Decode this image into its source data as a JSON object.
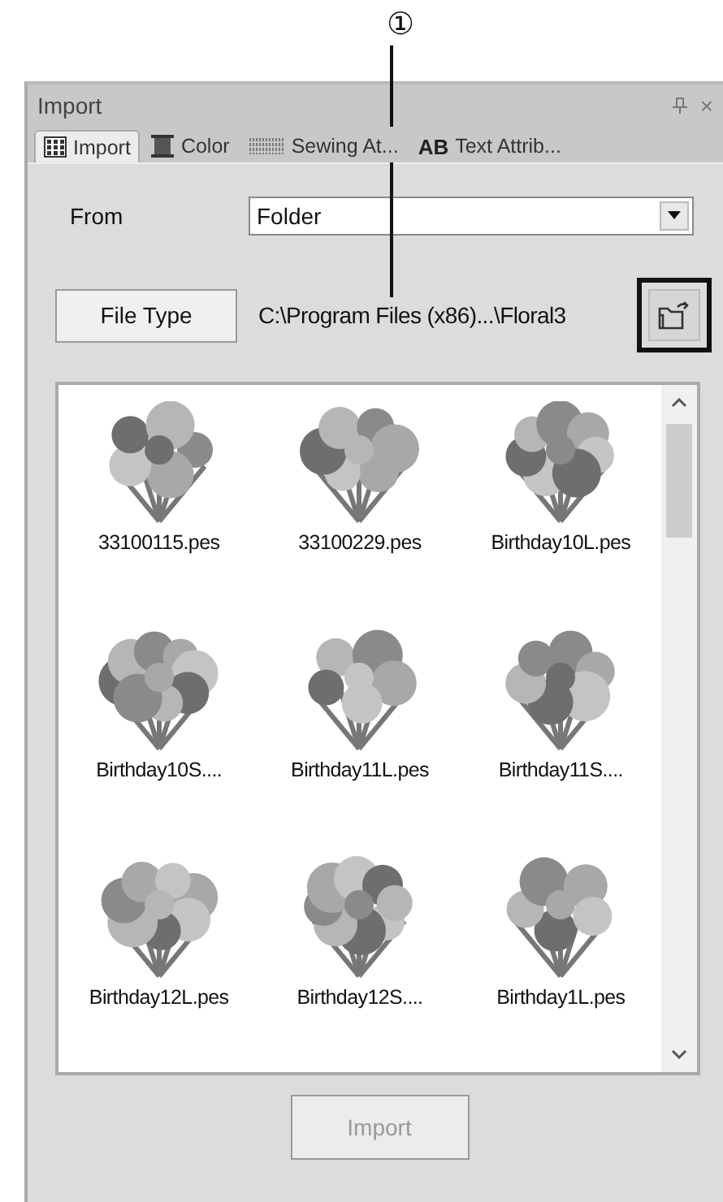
{
  "callout": {
    "label": "①"
  },
  "panel": {
    "title": "Import",
    "close": "×"
  },
  "tabs": [
    {
      "label": "Import",
      "selected": true,
      "kind": "grid"
    },
    {
      "label": "Color",
      "selected": false,
      "kind": "spool"
    },
    {
      "label": "Sewing At...",
      "selected": false,
      "kind": "stitch"
    },
    {
      "label": "Text Attrib...",
      "selected": false,
      "kind": "text",
      "badge": "AB"
    }
  ],
  "from": {
    "label": "From",
    "value": "Folder"
  },
  "file_type_button": "File Type",
  "path": "C:\\Program Files (x86)...\\Floral3",
  "files": [
    {
      "name": "33100115.pes"
    },
    {
      "name": "33100229.pes"
    },
    {
      "name": "Birthday10L.pes"
    },
    {
      "name": "Birthday10S...."
    },
    {
      "name": "Birthday11L.pes"
    },
    {
      "name": "Birthday11S...."
    },
    {
      "name": "Birthday12L.pes"
    },
    {
      "name": "Birthday12S...."
    },
    {
      "name": "Birthday1L.pes"
    }
  ],
  "import_button": {
    "label": "Import",
    "disabled": true
  }
}
